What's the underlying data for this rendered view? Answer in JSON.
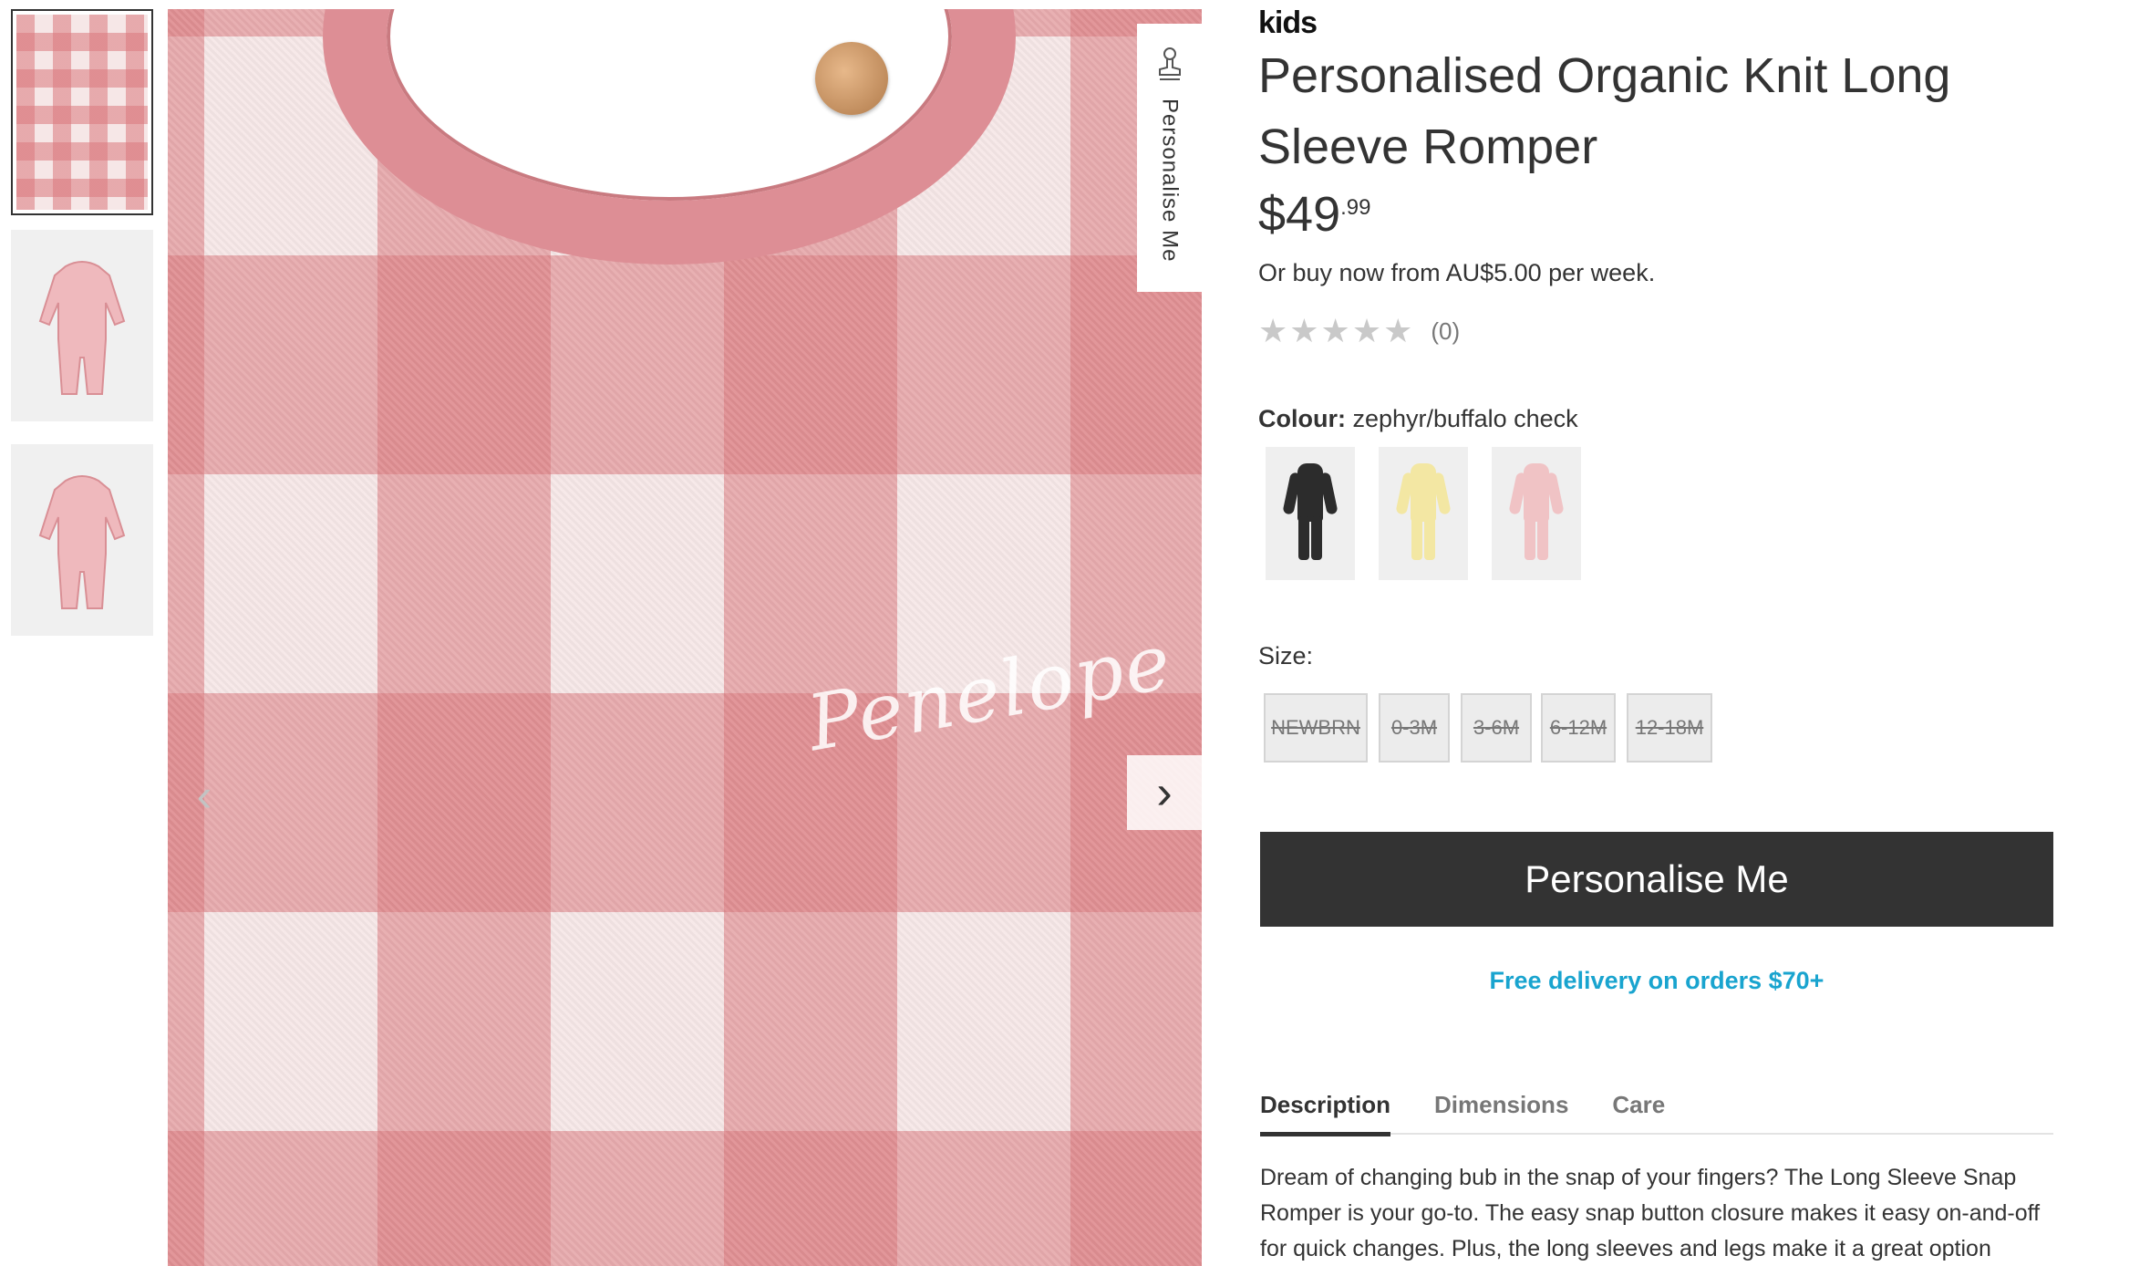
{
  "brand": {
    "name": "kids",
    "prefix": ""
  },
  "product": {
    "title": "Personalised Organic Knit Long Sleeve Romper",
    "price_whole": "$49",
    "price_cents": ".99",
    "afterpay_text": "Or buy now from AU$5.00 per week.",
    "rating_stars": "★★★★★",
    "review_count": "(0)",
    "rating_value": 0
  },
  "gallery": {
    "personalise_tab_label": "Personalise Me",
    "embroidery_text": "Penelope",
    "prev_icon": "‹",
    "next_icon": "›"
  },
  "colour": {
    "label": "Colour:",
    "selected": "zephyr/buffalo check",
    "swatches": [
      {
        "name": "black",
        "color": "#2c2c2c"
      },
      {
        "name": "yellow",
        "color": "#f3e7a3"
      },
      {
        "name": "pink",
        "color": "#f0c3c5"
      }
    ]
  },
  "size": {
    "label": "Size:",
    "options": [
      "NEWBRN",
      "0-3M",
      "3-6M",
      "6-12M",
      "12-18M"
    ]
  },
  "cta": {
    "label": "Personalise Me"
  },
  "delivery": {
    "text": "Free delivery on orders $70+"
  },
  "tabs": [
    {
      "label": "Description",
      "active": true
    },
    {
      "label": "Dimensions",
      "active": false
    },
    {
      "label": "Care",
      "active": false
    }
  ],
  "description": "Dream of changing bub in the snap of your fingers? The Long Sleeve Snap Romper is your go-to. The easy snap button closure makes it easy on-and-off for quick changes. Plus, the long sleeves and legs make it a great option",
  "colors": {
    "accent": "#19a4cf",
    "cta_bg": "#333333",
    "gingham_pink": "#da787d"
  }
}
